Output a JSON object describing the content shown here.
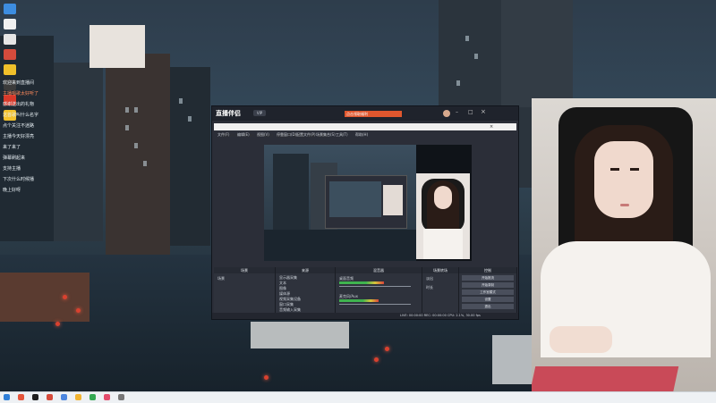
{
  "desktop": {
    "icons": [
      {
        "name": "desktop-icon-1",
        "color": "#3d8de0"
      },
      {
        "name": "desktop-icon-2",
        "color": "#f0f0f0"
      },
      {
        "name": "desktop-icon-3",
        "color": "#e5e5e5"
      },
      {
        "name": "desktop-icon-4",
        "color": "#d54b3c"
      },
      {
        "name": "desktop-icon-5",
        "color": "#f0c02a"
      },
      {
        "name": "desktop-icon-6",
        "color": "#3b3b3b"
      },
      {
        "name": "desktop-icon-7",
        "color": "#d93a2b"
      },
      {
        "name": "desktop-icon-8",
        "color": "#f2c12c"
      }
    ]
  },
  "chat": {
    "lines": [
      {
        "text": "欢迎来到直播间",
        "highlight": false
      },
      {
        "text": "主播唱歌太好听了",
        "highlight": true
      },
      {
        "text": "感谢送出的礼物",
        "highlight": false
      },
      {
        "text": "这首歌叫什么名字",
        "highlight": false
      },
      {
        "text": "点个关注不迷路",
        "highlight": false
      },
      {
        "text": "主播今天好漂亮",
        "highlight": false
      },
      {
        "text": "来了来了",
        "highlight": false
      },
      {
        "text": "弹幕刷起来",
        "highlight": false
      },
      {
        "text": "支持主播",
        "highlight": false
      },
      {
        "text": "下次什么时候播",
        "highlight": false
      },
      {
        "text": "晚上好呀",
        "highlight": false
      }
    ]
  },
  "obs": {
    "brand": "直播伴侣",
    "badge": "VIP",
    "promo": "点击领取福利",
    "title": "OBS 28.0.1 (64-bit, windows) - 配置文件: 未命名 - 场景: 未命名",
    "menu": [
      "文件(F)",
      "编辑(E)",
      "视图(V)",
      "停靠窗口(D)",
      "配置文件(P)",
      "场景集合(S)",
      "工具(T)",
      "帮助(H)"
    ],
    "docks": {
      "scenes": {
        "header": "场景",
        "items": [
          "场景"
        ]
      },
      "sources": {
        "header": "来源",
        "items": [
          "显示器采集",
          "文本",
          "图像",
          "媒体源",
          "视频采集设备",
          "窗口采集",
          "音频输入采集"
        ]
      },
      "mixer": {
        "header": "混音器",
        "tracks": [
          {
            "label": "桌面音频",
            "level": 0.62
          },
          {
            "label": "麦克风/Aux",
            "level": 0.55
          }
        ]
      },
      "transitions": {
        "header": "场景转场",
        "items": [
          "淡出",
          "时长"
        ]
      },
      "controls": {
        "header": "控制",
        "buttons": [
          "开始推流",
          "开始录制",
          "工作室模式",
          "设置",
          "退出"
        ]
      }
    },
    "status": "LIVE: 00:00:00   REC: 00:00:00   CPU: 2.1%, 30.00 fps"
  },
  "taskbar": {
    "icons": [
      {
        "name": "windows-start-icon",
        "color": "#2f7fd8"
      },
      {
        "name": "taskbar-app-1",
        "color": "#e6553b"
      },
      {
        "name": "taskbar-app-2",
        "color": "#1f1f1f"
      },
      {
        "name": "taskbar-app-3",
        "color": "#d64b3b"
      },
      {
        "name": "taskbar-app-4",
        "color": "#4b86e0"
      },
      {
        "name": "taskbar-app-5",
        "color": "#f2b431"
      },
      {
        "name": "taskbar-app-6",
        "color": "#34a852"
      },
      {
        "name": "taskbar-app-7",
        "color": "#e34b6c"
      },
      {
        "name": "taskbar-app-8",
        "color": "#777777"
      }
    ]
  }
}
